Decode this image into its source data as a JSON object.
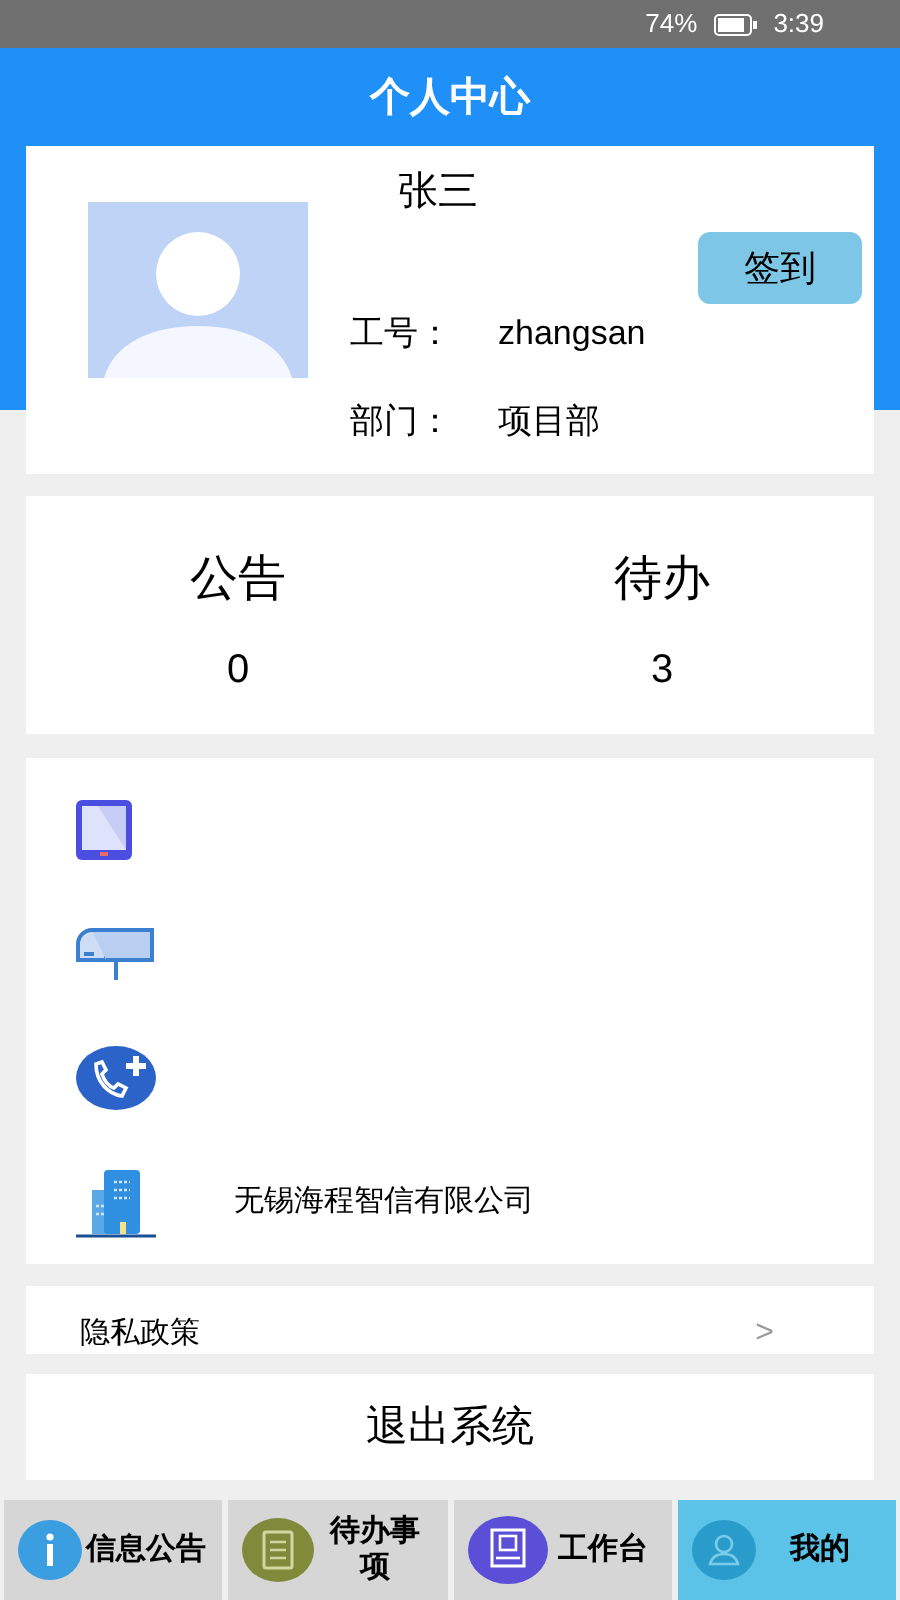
{
  "status_bar": {
    "battery": "74%",
    "time": "3:39"
  },
  "header": {
    "title": "个人中心"
  },
  "profile": {
    "name": "张三",
    "sign_in_button": "签到",
    "fields": [
      {
        "label": "工号：",
        "value": "zhangsan"
      },
      {
        "label": "部门：",
        "value": "项目部"
      }
    ]
  },
  "stats": [
    {
      "label": "公告",
      "count": "0"
    },
    {
      "label": "待办",
      "count": "3"
    }
  ],
  "contacts": {
    "company": "无锡海程智信有限公司"
  },
  "privacy": {
    "label": "隐私政策",
    "chevron": ">"
  },
  "logout_button": "退出系统",
  "tabs": [
    {
      "label": "信息公告",
      "selected": false
    },
    {
      "label": "待办事项",
      "selected": false
    },
    {
      "label": "工作台",
      "selected": false
    },
    {
      "label": "我的",
      "selected": true
    }
  ]
}
